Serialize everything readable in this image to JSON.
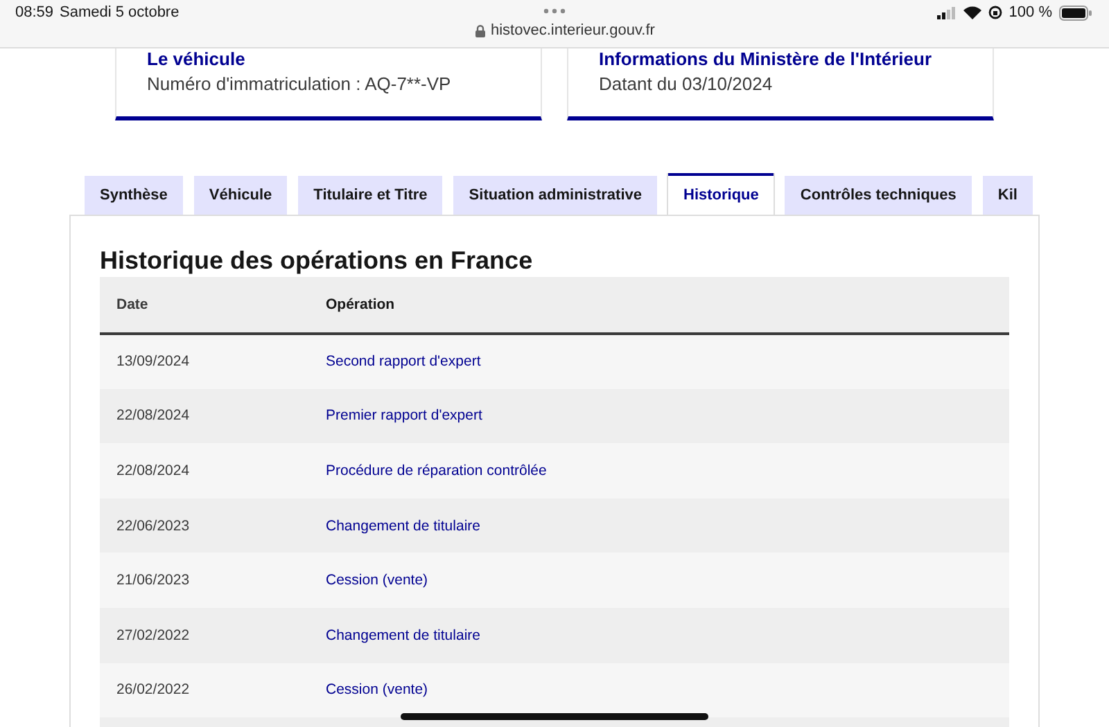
{
  "status_bar": {
    "time": "08:59",
    "date": "Samedi 5 octobre",
    "url": "histovec.interieur.gouv.fr",
    "battery": "100 %"
  },
  "cards": [
    {
      "title": "Le véhicule",
      "text": "Numéro d'immatriculation : AQ-7**-VP"
    },
    {
      "title": "Informations du Ministère de l'Intérieur",
      "text": "Datant du 03/10/2024"
    }
  ],
  "tabs": [
    {
      "label": "Synthèse",
      "selected": false
    },
    {
      "label": "Véhicule",
      "selected": false
    },
    {
      "label": "Titulaire et Titre",
      "selected": false
    },
    {
      "label": "Situation administrative",
      "selected": false
    },
    {
      "label": "Historique",
      "selected": true
    },
    {
      "label": "Contrôles techniques",
      "selected": false
    },
    {
      "label": "Kil",
      "selected": false
    }
  ],
  "section": {
    "title": "Historique des opérations en France",
    "table": {
      "columns": [
        "Date",
        "Opération"
      ],
      "rows": [
        [
          "13/09/2024",
          "Second rapport d'expert"
        ],
        [
          "22/08/2024",
          "Premier rapport d'expert"
        ],
        [
          "22/08/2024",
          "Procédure de réparation contrôlée"
        ],
        [
          "22/06/2023",
          "Changement de titulaire"
        ],
        [
          "21/06/2023",
          "Cession (vente)"
        ],
        [
          "27/02/2022",
          "Changement de titulaire"
        ],
        [
          "26/02/2022",
          "Cession (vente)"
        ]
      ]
    }
  }
}
